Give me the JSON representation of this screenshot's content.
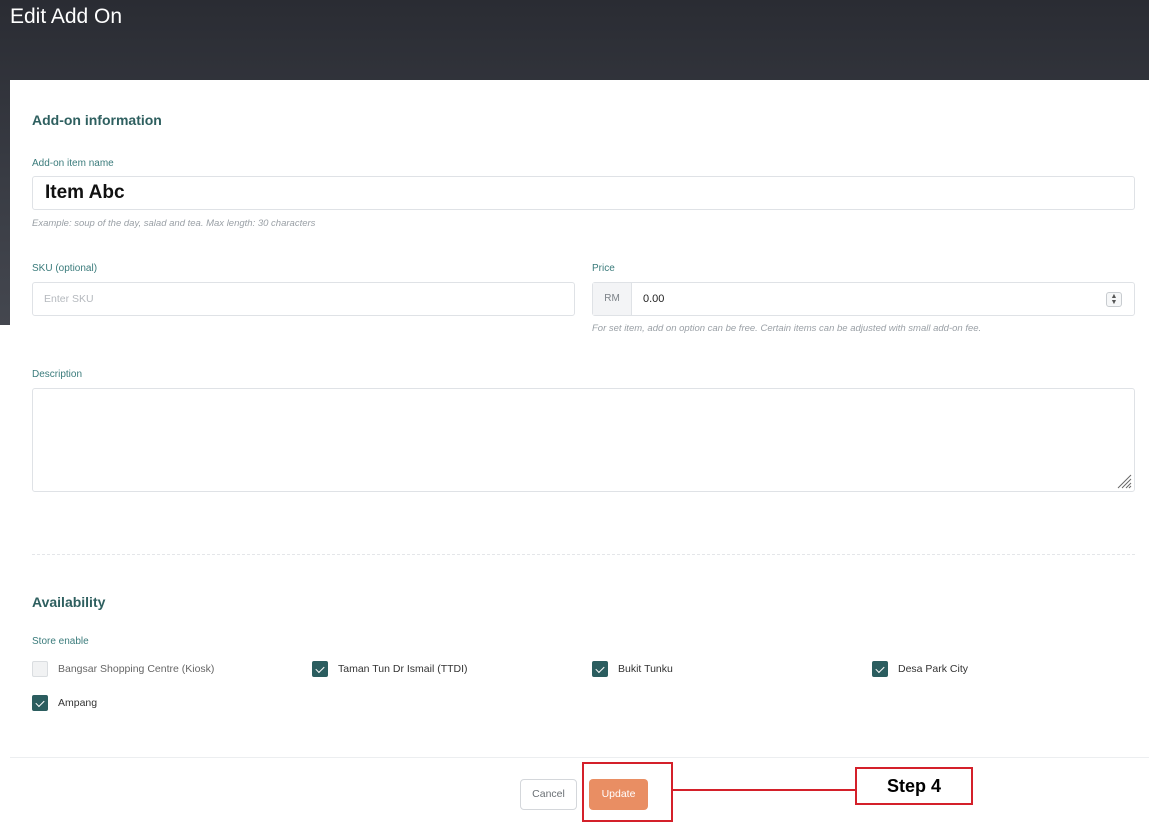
{
  "page": {
    "title": "Edit Add On"
  },
  "form": {
    "section_info_title": "Add-on information",
    "item_name": {
      "label": "Add-on item name",
      "value": "Item Abc",
      "hint": "Example: soup of the day, salad and tea. Max length: 30 characters"
    },
    "sku": {
      "label": "SKU (optional)",
      "value": "",
      "placeholder": "Enter SKU"
    },
    "price": {
      "label": "Price",
      "currency": "RM",
      "value": "0.00",
      "hint": "For set item, add on option can be free. Certain items can be adjusted with small add-on fee."
    },
    "description": {
      "label": "Description",
      "value": ""
    }
  },
  "availability": {
    "title": "Availability",
    "store_enable_label": "Store enable",
    "stores": [
      {
        "name": "Bangsar Shopping Centre (Kiosk)",
        "checked": false
      },
      {
        "name": "Taman Tun Dr Ismail (TTDI)",
        "checked": true
      },
      {
        "name": "Bukit Tunku",
        "checked": true
      },
      {
        "name": "Desa Park City",
        "checked": true
      },
      {
        "name": "Ampang",
        "checked": true
      }
    ]
  },
  "footer": {
    "cancel_label": "Cancel",
    "update_label": "Update"
  },
  "annotation": {
    "step_label": "Step 4",
    "color": "#d4202a"
  },
  "colors": {
    "accent": "#2b5d5f",
    "primary_button": "#e98e63",
    "label_teal": "#3a7b7b"
  }
}
